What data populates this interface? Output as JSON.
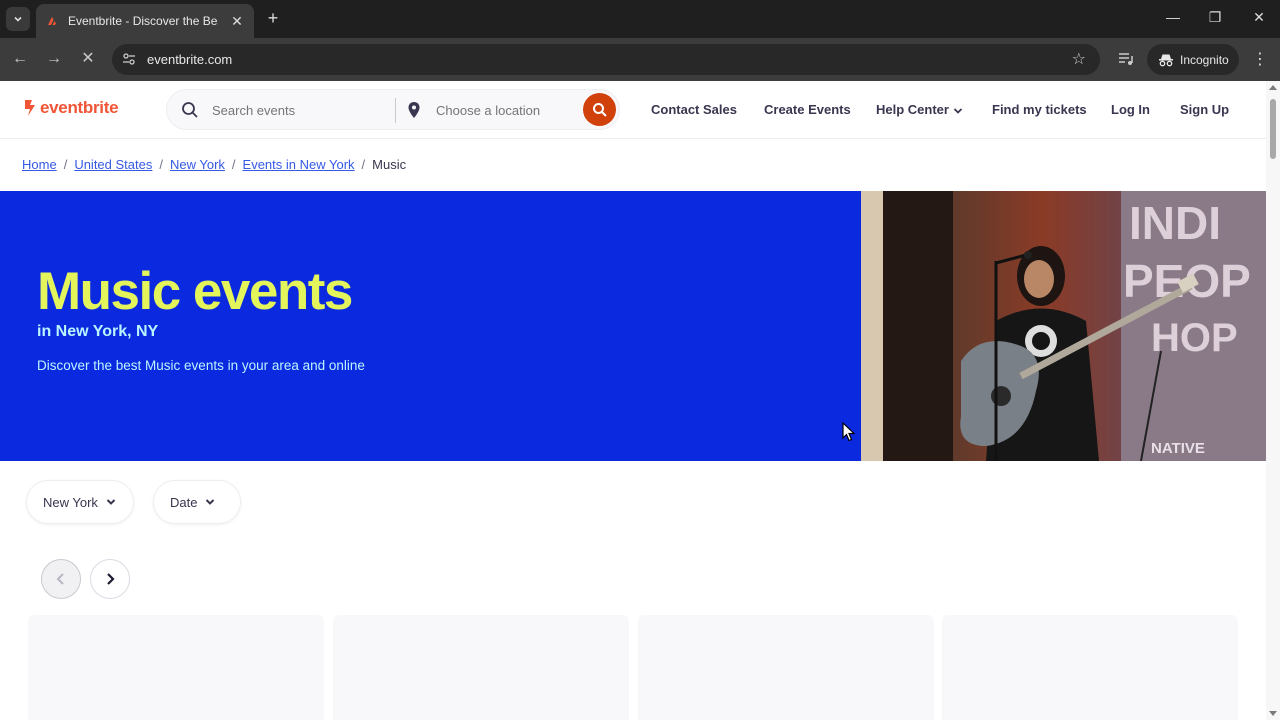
{
  "browser": {
    "tab_title": "Eventbrite - Discover the Best Local Events & Things to Do",
    "url": "eventbrite.com",
    "incognito_label": "Incognito"
  },
  "header": {
    "logo_text": "eventbrite",
    "search_placeholder": "Search events",
    "location_placeholder": "Choose a location",
    "nav": [
      "Contact Sales",
      "Create Events",
      "Help Center",
      "Find my tickets",
      "Log In",
      "Sign Up"
    ]
  },
  "breadcrumb": [
    "Home",
    "United States",
    "New York",
    "Events in New York",
    "Music"
  ],
  "hero": {
    "title": "Music events",
    "subtitle": "in New York, NY",
    "description": "Discover the best Music events in your area and online",
    "photo_text": [
      "INDI",
      "PEOP",
      "HOP",
      "NATIVE"
    ]
  },
  "filters": {
    "location": "New York",
    "date": "Date"
  },
  "colors": {
    "brand": "#f05537",
    "hero_bg": "#0b2ae0",
    "hero_title": "#e3f55b",
    "search_button": "#d1410c"
  }
}
